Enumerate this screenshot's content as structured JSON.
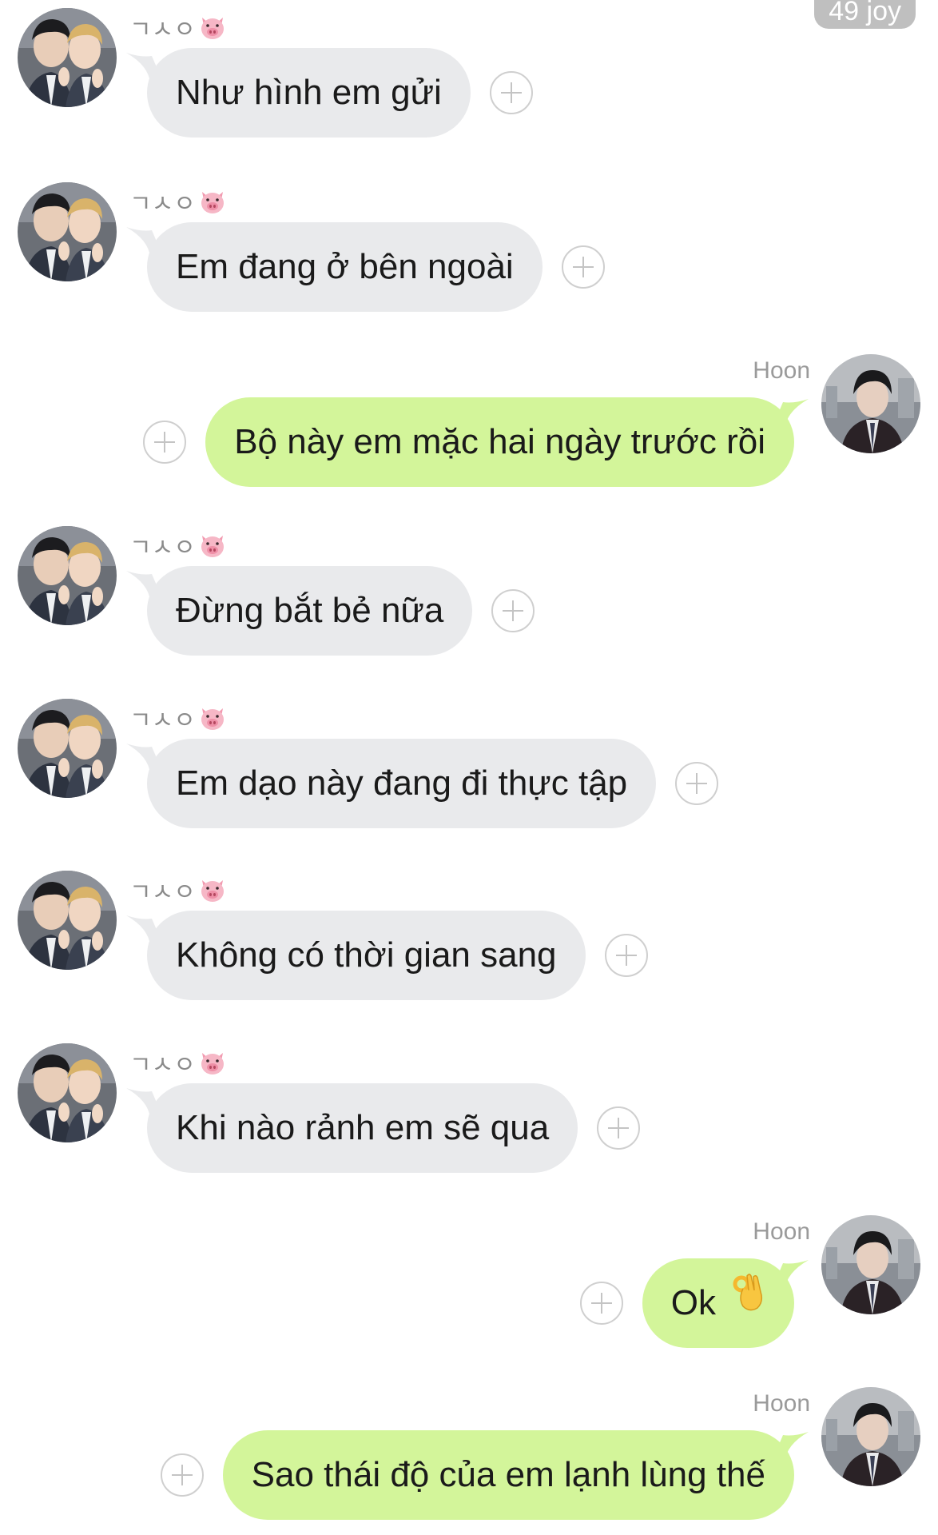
{
  "header": {
    "count_badge": "49 joy"
  },
  "participants": {
    "other_name": "ㄱㅅㅇ",
    "other_emoji_icon": "pig-face-icon",
    "self_name": "Hoon"
  },
  "colors": {
    "incoming_bubble": "#e9eaec",
    "outgoing_bubble": "#d3f59a",
    "sender_label": "#9a9a9a"
  },
  "messages": [
    {
      "from": "other",
      "sender": "ㄱㅅㅇ",
      "text": "Như hình em gửi"
    },
    {
      "from": "other",
      "sender": "ㄱㅅㅇ",
      "text": "Em đang ở bên ngoài"
    },
    {
      "from": "self",
      "sender": "Hoon",
      "text": "Bộ này em mặc hai ngày trước rồi"
    },
    {
      "from": "other",
      "sender": "ㄱㅅㅇ",
      "text": "Đừng bắt bẻ nữa"
    },
    {
      "from": "other",
      "sender": "ㄱㅅㅇ",
      "text": "Em dạo này đang đi thực tập"
    },
    {
      "from": "other",
      "sender": "ㄱㅅㅇ",
      "text": "Không có thời gian sang"
    },
    {
      "from": "other",
      "sender": "ㄱㅅㅇ",
      "text": "Khi nào rảnh em sẽ qua"
    },
    {
      "from": "self",
      "sender": "Hoon",
      "text": "Ok",
      "emoji_icon": "ok-hand-icon"
    },
    {
      "from": "self",
      "sender": "Hoon",
      "text": "Sao thái độ của em lạnh lùng thế"
    }
  ]
}
